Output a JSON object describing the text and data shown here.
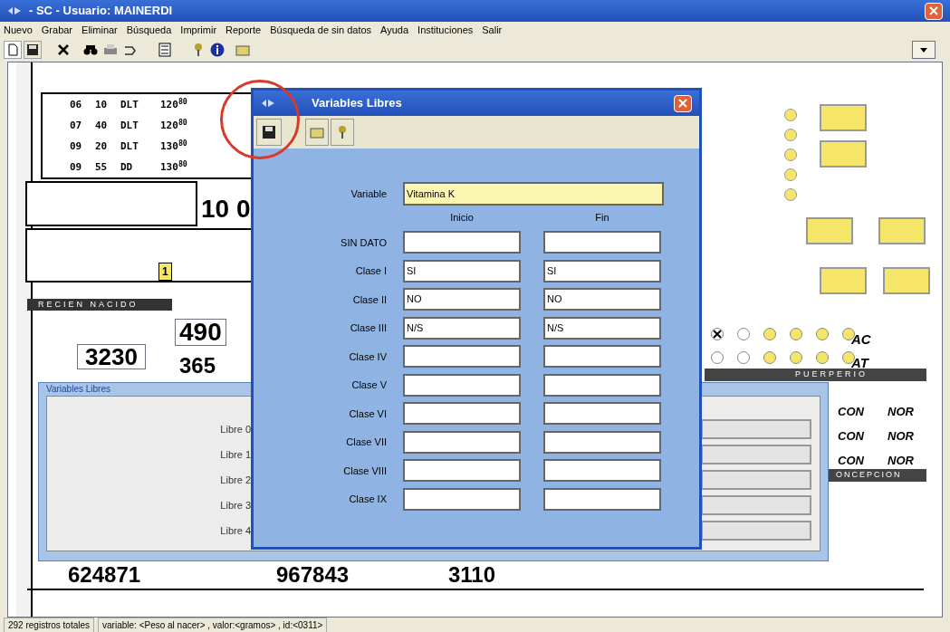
{
  "window": {
    "title": "- SC - Usuario: MAINERDI"
  },
  "menu": [
    "Nuevo",
    "Grabar",
    "Eliminar",
    "Búsqueda",
    "Imprimir",
    "Reporte",
    "Búsqueda de sin datos",
    "Ayuda",
    "Instituciones",
    "Salir"
  ],
  "form": {
    "grid_rows": [
      [
        "06",
        "10",
        "DLT",
        "120$^{80}$"
      ],
      [
        "07",
        "40",
        "DLT",
        "120$^{80}$"
      ],
      [
        "09",
        "20",
        "DLT",
        "130$^{80}$"
      ],
      [
        "09",
        "55",
        "DD",
        "130$^{80}$"
      ]
    ],
    "big_value": "10 0",
    "small_box": "1",
    "newborn_header": "RECIEN NACIDO",
    "value_a": "490",
    "weight": "3230",
    "value_b": "365",
    "apgar_rows": [
      {
        "label": "AC",
        "marks": [
          {
            "crossed": true,
            "filled": false
          },
          {
            "crossed": false,
            "filled": false
          },
          {
            "crossed": false,
            "filled": true
          },
          {
            "crossed": false,
            "filled": true
          },
          {
            "crossed": false,
            "filled": true
          },
          {
            "crossed": false,
            "filled": true
          }
        ]
      },
      {
        "label": "AT",
        "marks": [
          {
            "crossed": false,
            "filled": false
          },
          {
            "crossed": false,
            "filled": false
          },
          {
            "crossed": false,
            "filled": true
          },
          {
            "crossed": false,
            "filled": true
          },
          {
            "crossed": false,
            "filled": true
          },
          {
            "crossed": false,
            "filled": true
          }
        ]
      }
    ],
    "puerperio_header": "PUERPERIO",
    "puerperio_rows": [
      [
        "CON",
        "NOR"
      ],
      [
        "CON",
        "NOR"
      ],
      [
        "CON",
        "NOR"
      ]
    ],
    "concepcion_header": "ONCEPCION",
    "bottom_numbers": [
      "624871",
      "967843",
      "3110"
    ]
  },
  "back_dialog": {
    "title": "Variables Libres",
    "rows": [
      "Libre 0",
      "Libre 1",
      "Libre 2",
      "Libre 3",
      "Libre 4"
    ]
  },
  "dialog": {
    "title": "Variables Libres",
    "variable_label": "Variable",
    "variable_value": "Vitamina K",
    "columns": [
      "Inicio",
      "Fin"
    ],
    "rows": [
      {
        "label": "SIN DATO"
      },
      {
        "label": "Clase I",
        "start": "SI",
        "end": "SI"
      },
      {
        "label": "Clase II",
        "start": "NO",
        "end": "NO"
      },
      {
        "label": "Clase III",
        "start": "N/S",
        "end": "N/S"
      },
      {
        "label": "Clase IV"
      },
      {
        "label": "Clase V"
      },
      {
        "label": "Clase VI"
      },
      {
        "label": "Clase VII"
      },
      {
        "label": "Clase VIII"
      },
      {
        "label": "Clase IX"
      }
    ]
  },
  "status_bar": [
    "292 registros totales",
    "variable: <Peso al nacer> , valor:<gramos> , id:<0311>"
  ]
}
